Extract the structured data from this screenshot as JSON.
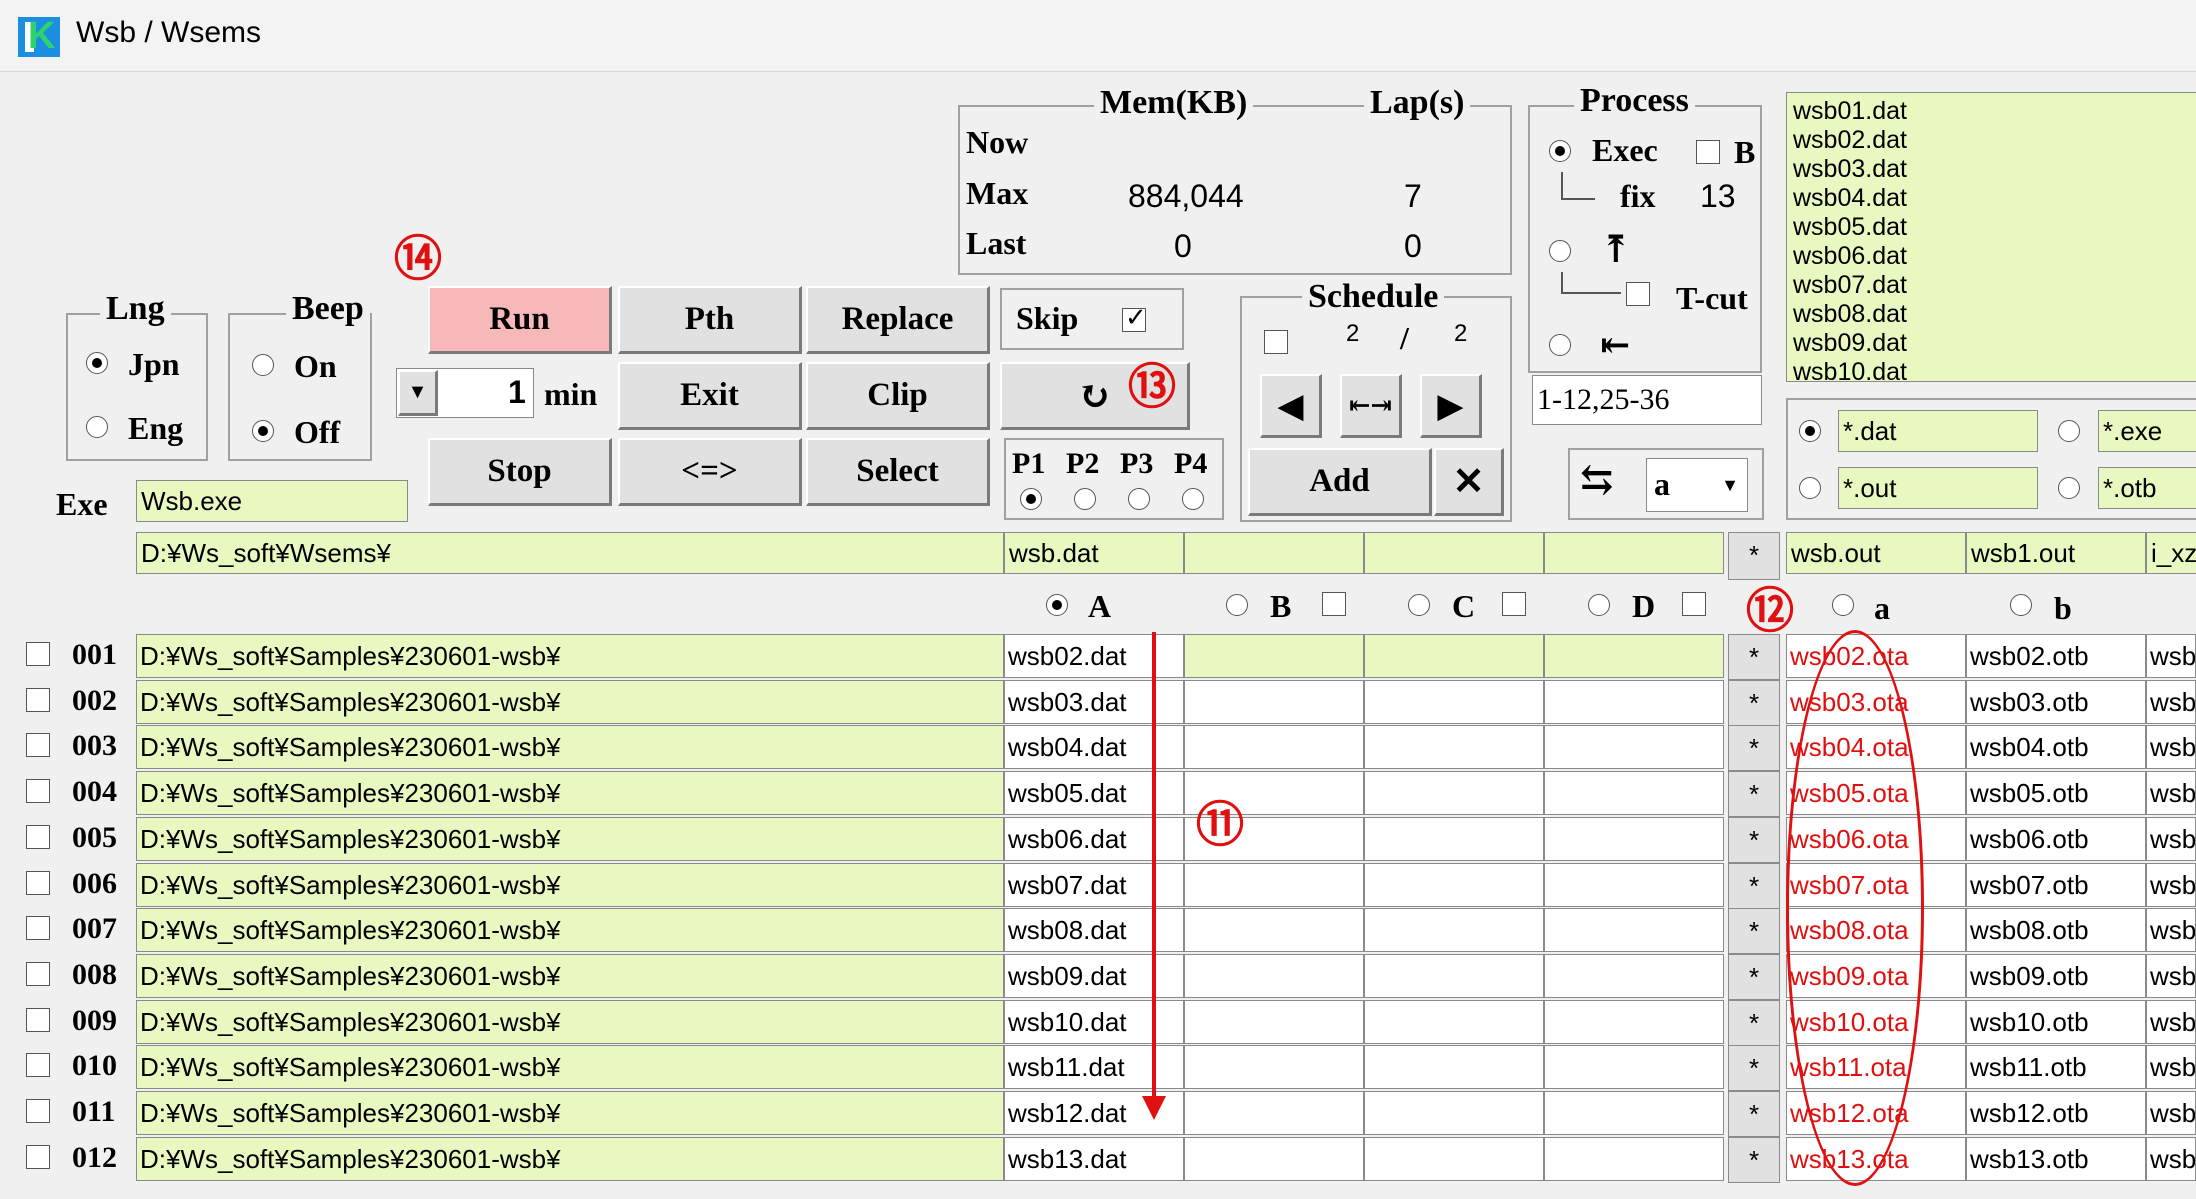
{
  "window": {
    "title": "Wsb / Wsems"
  },
  "mem": {
    "legend": "Mem(KB)",
    "lap_legend": "Lap(s)",
    "now_label": "Now",
    "max_label": "Max",
    "last_label": "Last",
    "max_mem": "884,044",
    "max_lap": "7",
    "last_mem": "0",
    "last_lap": "0"
  },
  "process": {
    "legend": "Process",
    "exec_label": "Exec",
    "b_label": "B",
    "fix_label": "fix",
    "fix_value": "13",
    "up_icon": "⤒",
    "tcut_label": "T-cut",
    "left_icon": "⇤",
    "range_value": "1-12,25-36"
  },
  "files_list": [
    "wsb01.dat",
    "wsb02.dat",
    "wsb03.dat",
    "wsb04.dat",
    "wsb05.dat",
    "wsb06.dat",
    "wsb07.dat",
    "wsb08.dat",
    "wsb09.dat",
    "wsb10.dat"
  ],
  "filters": {
    "dat": "*.dat",
    "exe": "*.exe",
    "out": "*.out",
    "otb": "*.otb"
  },
  "lng": {
    "legend": "Lng",
    "jpn": "Jpn",
    "eng": "Eng"
  },
  "beep": {
    "legend": "Beep",
    "on": "On",
    "off": "Off"
  },
  "buttons": {
    "run": "Run",
    "pth": "Pth",
    "replace": "Replace",
    "skip": "Skip",
    "exit": "Exit",
    "clip": "Clip",
    "refresh": "↻",
    "stop": "Stop",
    "swap": "<=>",
    "select": "Select",
    "add": "Add",
    "close": "✕",
    "prev": "◀",
    "mid": "⇤⇥",
    "next": "▶",
    "swap_icon": "⇆",
    "dropdown": "▼"
  },
  "interval": {
    "value": "1",
    "unit": "min"
  },
  "schedule": {
    "legend": "Schedule",
    "num1": "2",
    "slash": "/",
    "num2": "2"
  },
  "ports": {
    "p1": "P1",
    "p2": "P2",
    "p3": "P3",
    "p4": "P4"
  },
  "combo": {
    "value": "a"
  },
  "exe": {
    "label": "Exe",
    "value": "Wsb.exe"
  },
  "base_path": "D:¥Ws_soft¥Wsems¥",
  "base_file": "wsb.dat",
  "out_headers": [
    "wsb.out",
    "wsb1.out",
    "i_xz"
  ],
  "cols_in": {
    "a": "A",
    "b": "B",
    "c": "C",
    "d": "D"
  },
  "cols_out": {
    "a": "a",
    "b": "b"
  },
  "star": "*",
  "annotations": {
    "n11": "⑪",
    "n12": "⑫",
    "n13": "⑬",
    "n14": "⑭"
  },
  "rows": [
    {
      "num": "001",
      "path": "D:¥Ws_soft¥Samples¥230601-wsb¥",
      "dat": "wsb02.dat",
      "ota": "wsb02.ota",
      "otb": "wsb02.otb",
      "more": "wsb"
    },
    {
      "num": "002",
      "path": "D:¥Ws_soft¥Samples¥230601-wsb¥",
      "dat": "wsb03.dat",
      "ota": "wsb03.ota",
      "otb": "wsb03.otb",
      "more": "wsb"
    },
    {
      "num": "003",
      "path": "D:¥Ws_soft¥Samples¥230601-wsb¥",
      "dat": "wsb04.dat",
      "ota": "wsb04.ota",
      "otb": "wsb04.otb",
      "more": "wsb"
    },
    {
      "num": "004",
      "path": "D:¥Ws_soft¥Samples¥230601-wsb¥",
      "dat": "wsb05.dat",
      "ota": "wsb05.ota",
      "otb": "wsb05.otb",
      "more": "wsb"
    },
    {
      "num": "005",
      "path": "D:¥Ws_soft¥Samples¥230601-wsb¥",
      "dat": "wsb06.dat",
      "ota": "wsb06.ota",
      "otb": "wsb06.otb",
      "more": "wsb"
    },
    {
      "num": "006",
      "path": "D:¥Ws_soft¥Samples¥230601-wsb¥",
      "dat": "wsb07.dat",
      "ota": "wsb07.ota",
      "otb": "wsb07.otb",
      "more": "wsb"
    },
    {
      "num": "007",
      "path": "D:¥Ws_soft¥Samples¥230601-wsb¥",
      "dat": "wsb08.dat",
      "ota": "wsb08.ota",
      "otb": "wsb08.otb",
      "more": "wsb"
    },
    {
      "num": "008",
      "path": "D:¥Ws_soft¥Samples¥230601-wsb¥",
      "dat": "wsb09.dat",
      "ota": "wsb09.ota",
      "otb": "wsb09.otb",
      "more": "wsb"
    },
    {
      "num": "009",
      "path": "D:¥Ws_soft¥Samples¥230601-wsb¥",
      "dat": "wsb10.dat",
      "ota": "wsb10.ota",
      "otb": "wsb10.otb",
      "more": "wsb"
    },
    {
      "num": "010",
      "path": "D:¥Ws_soft¥Samples¥230601-wsb¥",
      "dat": "wsb11.dat",
      "ota": "wsb11.ota",
      "otb": "wsb11.otb",
      "more": "wsb"
    },
    {
      "num": "011",
      "path": "D:¥Ws_soft¥Samples¥230601-wsb¥",
      "dat": "wsb12.dat",
      "ota": "wsb12.ota",
      "otb": "wsb12.otb",
      "more": "wsb"
    },
    {
      "num": "012",
      "path": "D:¥Ws_soft¥Samples¥230601-wsb¥",
      "dat": "wsb13.dat",
      "ota": "wsb13.ota",
      "otb": "wsb13.otb",
      "more": "wsb"
    }
  ],
  "colors": {
    "accent_red": "#e01010",
    "field_green": "#e8f8c0",
    "run_pink": "#f6b8b8"
  }
}
